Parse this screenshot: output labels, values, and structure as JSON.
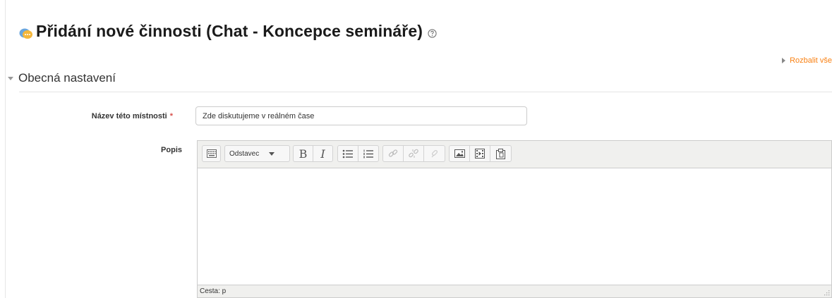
{
  "page": {
    "title": "Přidání nové činnosti (Chat - Koncepce semináře)",
    "expand_all": "Rozbalit vše"
  },
  "section": {
    "title": "Obecná nastavení"
  },
  "fields": {
    "name": {
      "label": "Název této místnosti",
      "required_marker": "*",
      "value": "Zde diskutujeme v reálném čase"
    },
    "description": {
      "label": "Popis"
    }
  },
  "editor": {
    "toolbar": {
      "format_select": "Odstavec",
      "bold": "B",
      "italic": "I",
      "icons": [
        "show-more-buttons-icon",
        "bullet-list-icon",
        "numbered-list-icon",
        "link-icon",
        "unlink-icon",
        "anchor-icon",
        "image-icon",
        "media-icon",
        "manage-files-icon"
      ]
    },
    "status_path": "Cesta: p"
  },
  "colors": {
    "accent_link": "#f98012",
    "required": "#d9534f",
    "toolbar_bg": "#f0f0ee",
    "border": "#cccccc"
  }
}
